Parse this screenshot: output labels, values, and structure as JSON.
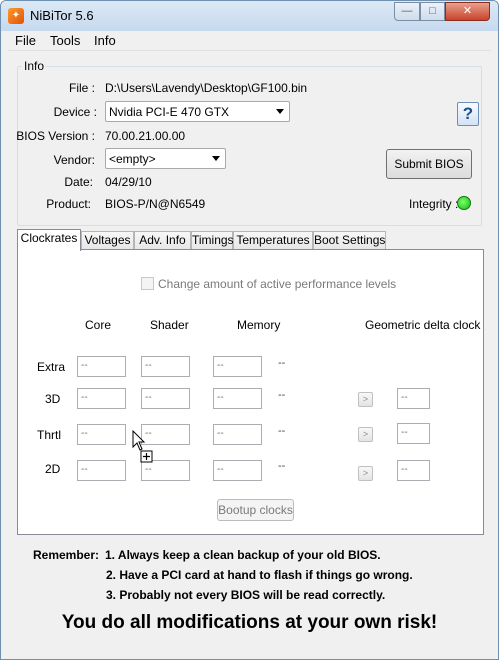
{
  "window": {
    "title": "NiBiTor 5.6",
    "min": "—",
    "max": "□",
    "close": "✕"
  },
  "menu": [
    "File",
    "Tools",
    "Info"
  ],
  "info": {
    "group_label": "Info",
    "file_label": "File :",
    "file_value": "D:\\Users\\Lavendy\\Desktop\\GF100.bin",
    "device_label": "Device :",
    "device_value": "Nvidia PCI-E 470 GTX",
    "bios_label": "BIOS Version :",
    "bios_value": "70.00.21.00.00",
    "vendor_label": "Vendor:",
    "vendor_value": "<empty>",
    "date_label": "Date:",
    "date_value": "04/29/10",
    "product_label": "Product:",
    "product_value": "BIOS-P/N@N6549",
    "help_label": "?",
    "submit_label": "Submit BIOS",
    "integrity_label": "Integrity :",
    "integrity_color": "#15b810"
  },
  "tabs": [
    "Clockrates",
    "Voltages",
    "Adv. Info",
    "Timings",
    "Temperatures",
    "Boot Settings"
  ],
  "clockrates": {
    "checkbox_label": "Change amount of active performance levels",
    "columns": {
      "core": "Core",
      "shader": "Shader",
      "memory": "Memory",
      "geometric": "Geometric delta clock"
    },
    "rows": [
      {
        "label": "Extra",
        "core": "--",
        "shader": "--",
        "memory": "--",
        "mem_suffix": "--"
      },
      {
        "label": "3D",
        "core": "--",
        "shader": "--",
        "memory": "--",
        "mem_suffix": "--",
        "arrow": ">",
        "geo": "--"
      },
      {
        "label": "Thrtl",
        "core": "--",
        "shader": "--",
        "memory": "--",
        "mem_suffix": "--",
        "arrow": ">",
        "geo": "--"
      },
      {
        "label": "2D",
        "core": "--",
        "shader": "--",
        "memory": "--",
        "mem_suffix": "--",
        "arrow": ">",
        "geo": "--"
      }
    ],
    "bootup_label": "Bootup clocks"
  },
  "footer": {
    "remember_label": "Remember:",
    "line1": "1. Always keep a clean backup of your old BIOS.",
    "line2": "2. Have a PCI card at hand to flash if things go wrong.",
    "line3": "3. Probably not every BIOS will be read correctly.",
    "risk": "You do all modifications at your own risk!"
  }
}
